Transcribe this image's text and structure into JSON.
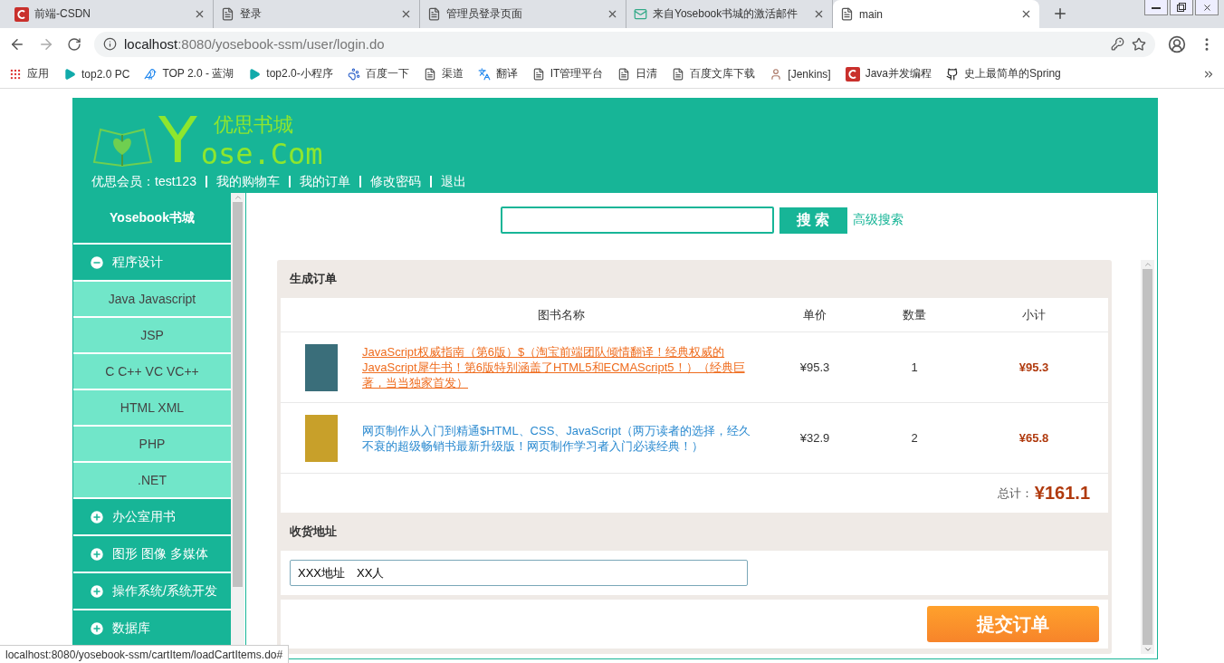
{
  "browser": {
    "tabs": [
      {
        "title": "前端-CSDN",
        "selected": false
      },
      {
        "title": "登录",
        "selected": false
      },
      {
        "title": "管理员登录页面",
        "selected": false
      },
      {
        "title": "来自Yosebook书城的激活邮件",
        "selected": false
      },
      {
        "title": "main",
        "selected": true
      }
    ],
    "url_host": "localhost",
    "url_rest": ":8080/yosebook-ssm/user/login.do",
    "bookmarks": [
      "应用",
      "top2.0 PC",
      "TOP 2.0 - 蓝湖",
      "top2.0-小程序",
      "百度一下",
      "渠道",
      "翻译",
      "IT管理平台",
      "日清",
      "百度文库下载",
      "[Jenkins]",
      "Java并发编程",
      "史上最简单的Spring"
    ],
    "status_url": "localhost:8080/yosebook-ssm/cartItem/loadCartItems.do#"
  },
  "header": {
    "logo_cn": "优思书城",
    "logo_initial": "Y",
    "logo_rest": "ose.Com",
    "nav": [
      "优思会员：test123",
      "我的购物车",
      "我的订单",
      "修改密码",
      "退出"
    ]
  },
  "sidebar": {
    "title": "Yosebook书城",
    "categories": [
      {
        "label": "程序设计",
        "expanded": true,
        "children": [
          "Java Javascript",
          "JSP",
          "C C++ VC VC++",
          "HTML XML",
          "PHP",
          ".NET"
        ]
      },
      {
        "label": "办公室用书",
        "expanded": false
      },
      {
        "label": "图形 图像 多媒体",
        "expanded": false
      },
      {
        "label": "操作系统/系统开发",
        "expanded": false
      },
      {
        "label": "数据库",
        "expanded": false
      }
    ]
  },
  "search": {
    "button": "搜 索",
    "advanced": "高级搜索"
  },
  "order": {
    "title": "生成订单",
    "columns": [
      "图书名称",
      "单价",
      "数量",
      "小计"
    ],
    "rows": [
      {
        "name": "JavaScript权威指南（第6版）$（淘宝前端团队倾情翻译！经典权威的JavaScript犀牛书！第6版特别涵盖了HTML5和ECMAScript5！）（经典巨著，当当独家首发）",
        "price": "¥95.3",
        "qty": "1",
        "subtotal": "¥95.3",
        "hovered": true
      },
      {
        "name": "网页制作从入门到精通$HTML、CSS、JavaScript（两万读者的选择，经久不衰的超级畅销书最新升级版！网页制作学习者入门必读经典！）",
        "price": "¥32.9",
        "qty": "2",
        "subtotal": "¥65.8",
        "hovered": false
      }
    ],
    "total_label": "总计：",
    "total": "¥161.1",
    "address_title": "收货地址",
    "address": "XXX地址　XX人",
    "submit": "提交订单"
  }
}
